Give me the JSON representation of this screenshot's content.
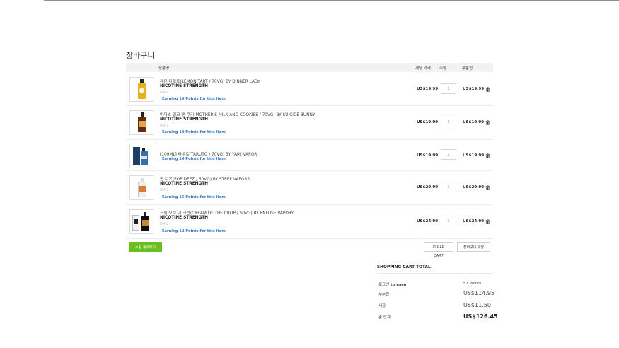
{
  "page": {
    "title": "장바구니"
  },
  "table": {
    "headers": {
      "product": "상품명",
      "unit_price": "개당 가격",
      "quantity": "수량",
      "subtotal": "부분합"
    },
    "rows": [
      {
        "name": "레몬 타르트(LEMON TART / 70VG) BY DINNER LADY",
        "nicotine_label": "NICOTINE STRENGTH",
        "nicotine_value": "0MG",
        "points": "Earning 10 Points for this item",
        "price": "US$19.99",
        "qty": "1",
        "subtotal": "US$19.99"
      },
      {
        "name": "마더스 밀크 앤 쿠키(MOTHER'S MILK AND COOKIES / 70VG) BY SUICIDE BUNNY",
        "nicotine_label": "NICOTINE STRENGTH",
        "nicotine_value": "0MG",
        "points": "Earning 10 Points for this item",
        "price": "US$19.99",
        "qty": "1",
        "subtotal": "US$19.99"
      },
      {
        "name": "[100ML] 타루토(TARUTO / 70VG) BY YAMI VAPOR",
        "points": "Earning 10 Points for this item",
        "price": "US$19.99",
        "qty": "1",
        "subtotal": "US$19.99"
      },
      {
        "name": "팝 디즈(POP DEEZ / 60VG) BY STEEP VAPORS",
        "nicotine_label": "NICOTINE STRENGTH",
        "nicotine_value": "0MG",
        "points": "Earning 15 Points for this item",
        "price": "US$29.99",
        "qty": "1",
        "subtotal": "US$29.99"
      },
      {
        "name": "크림 오브 더 크랍(CREAM OF THE CROP / 50VG) BY ENFUSE VAPORY",
        "nicotine_label": "NICOTINE STRENGTH",
        "nicotine_value": "0MG",
        "points": "Earning 12 Points for this item",
        "price": "US$24.99",
        "qty": "1",
        "subtotal": "US$24.99"
      }
    ]
  },
  "actions": {
    "continue_label": "쇼핑 계속하기",
    "clear_label": "CLEAR CART",
    "update_label": "장바구니 수정"
  },
  "totals": {
    "title": "SHOPPING CART TOTAL",
    "points_label_a": "로그인",
    "points_label_b": "to earn:",
    "points_value": "57 Points",
    "subtotal_label": "부분합",
    "subtotal_value": "US$114.95",
    "tax_label": "세금",
    "tax_value": "US$11.50",
    "total_label": "총 합계",
    "total_value": "US$126.45"
  },
  "colors": {
    "accent_green": "#6abf1f",
    "points_blue": "#3a79c5",
    "header_bg": "#f2f2f2"
  },
  "icons": [
    "trash-icon"
  ]
}
